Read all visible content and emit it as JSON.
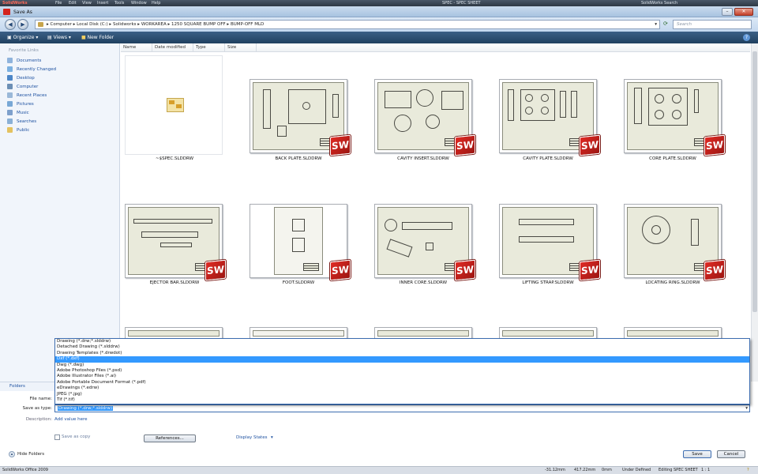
{
  "app": {
    "brand": "SolidWorks",
    "menus": [
      "File",
      "Edit",
      "View",
      "Insert",
      "Tools",
      "Window",
      "Help"
    ],
    "doc_title": "SPEC - SPEC SHEET",
    "search_label": "SolidWorks Search"
  },
  "dialog": {
    "title": "Save As"
  },
  "address": {
    "crumbs": [
      "Computer",
      "Local Disk (C:)",
      "Solidworks",
      "WORKAREA",
      "1250 SQUARE BUMP OFF",
      "BUMP-OFF MLD"
    ],
    "search_placeholder": "Search"
  },
  "toolbar": {
    "organize": "Organize",
    "views": "Views",
    "new_folder": "New Folder"
  },
  "nav": {
    "header": "Favorite Links",
    "items": [
      "Documents",
      "Recently Changed",
      "Desktop",
      "Computer",
      "Recent Places",
      "Pictures",
      "Music",
      "Searches",
      "Public"
    ],
    "folders_label": "Folders"
  },
  "columns": [
    "Name",
    "Date modified",
    "Type",
    "Size"
  ],
  "files": [
    "~$SPEC.SLDDRW",
    "BACK PLATE.SLDDRW",
    "CAVITY INSERT.SLDDRW",
    "CAVITY PLATE.SLDDRW",
    "CORE PLATE.SLDDRW",
    "EJECTOR BAR.SLDDRW",
    "FOOT.SLDDRW",
    "INNER CORE.SLDDRW",
    "LIFTING STRAP.SLDDRW",
    "LOCATING RING.SLDDRW"
  ],
  "badge_text": "SW",
  "save_type_options": [
    "Drawing (*.drw;*.slddrw)",
    "Detached Drawing (*.slddrw)",
    "Drawing Templates (*.drwdot)",
    "Dxf (*.dxf)",
    "Dwg (*.dwg)",
    "Adobe Photoshop Files (*.psd)",
    "Adobe Illustrator Files (*.ai)",
    "Adobe Portable Document Format (*.pdf)",
    "eDrawings (*.edrw)",
    "JPEG (*.jpg)",
    "Tif (*.tif)"
  ],
  "highlighted_option": "Dxf (*.dxf)",
  "form": {
    "file_name_label": "File name:",
    "save_as_type_label": "Save as type:",
    "save_as_type_value": "Drawing (*.drw;*.slddrw)",
    "description_label": "Description:",
    "description_link": "Add value here",
    "save_as_copy": "Save as copy",
    "references_button": "References...",
    "display_states": "Display States",
    "hide_folders": "Hide Folders",
    "save_button": "Save",
    "cancel_button": "Cancel"
  },
  "status": {
    "product": "SolidWorks Office 2009",
    "x": "-31.12mm",
    "y": "417.22mm",
    "z": "0mm",
    "state": "Under Defined",
    "editing": "Editing SPEC SHEET",
    "scale": "1 : 1"
  },
  "colors": {
    "accent": "#3399ff",
    "toolbar": "#2a4d72",
    "sw_badge": "#d4231d"
  }
}
